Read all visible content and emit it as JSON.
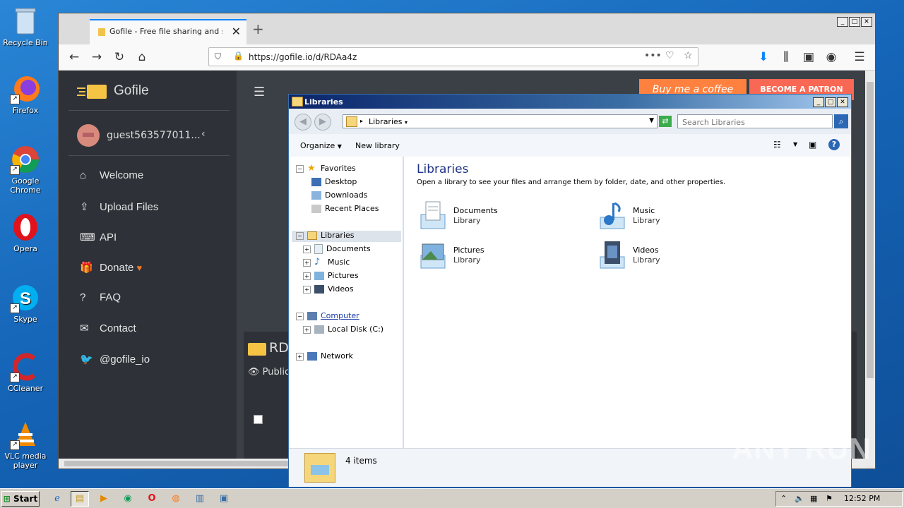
{
  "desktop": {
    "icons": [
      {
        "label": "Recycle Bin",
        "icon": "recycle-bin-icon"
      },
      {
        "label": "Firefox",
        "icon": "firefox-icon"
      },
      {
        "label": "Google Chrome",
        "icon": "chrome-icon"
      },
      {
        "label": "Opera",
        "icon": "opera-icon"
      },
      {
        "label": "Skype",
        "icon": "skype-icon"
      },
      {
        "label": "CCleaner",
        "icon": "ccleaner-icon"
      },
      {
        "label": "VLC media player",
        "icon": "vlc-icon"
      }
    ],
    "watermark": "ANY RUN"
  },
  "browser": {
    "tab_title": "Gofile - Free file sharing and storage",
    "url": "https://gofile.io/d/RDAa4z",
    "new_tab": "+"
  },
  "gofile": {
    "logo_text": "Gofile",
    "username": "guest563577011...",
    "menu": [
      {
        "label": "Welcome",
        "icon": "home-icon"
      },
      {
        "label": "Upload Files",
        "icon": "upload-file-icon"
      },
      {
        "label": "API",
        "icon": "api-icon"
      },
      {
        "label": "Donate",
        "icon": "gift-icon"
      },
      {
        "label": "FAQ",
        "icon": "question-icon"
      },
      {
        "label": "Contact",
        "icon": "envelope-icon"
      },
      {
        "label": "@gofile_io",
        "icon": "twitter-icon"
      }
    ],
    "buy_coffee": "Buy me a coffee",
    "become_patron": "BECOME A PATRON",
    "folder_name": "RD",
    "visibility": "Public"
  },
  "explorer": {
    "title": "Libraries",
    "breadcrumb": "Libraries",
    "search_placeholder": "Search Libraries",
    "commands": {
      "organize": "Organize",
      "new_library": "New library"
    },
    "heading": "Libraries",
    "subheading": "Open a library to see your files and arrange them by folder, date, and other properties.",
    "nav": {
      "favorites": "Favorites",
      "favorites_items": [
        "Desktop",
        "Downloads",
        "Recent Places"
      ],
      "libraries": "Libraries",
      "libraries_items": [
        "Documents",
        "Music",
        "Pictures",
        "Videos"
      ],
      "computer": "Computer",
      "local_disk": "Local Disk (C:)",
      "network": "Network"
    },
    "tiles": [
      {
        "name": "Documents",
        "type": "Library",
        "icon": "documents-library-icon"
      },
      {
        "name": "Music",
        "type": "Library",
        "icon": "music-library-icon"
      },
      {
        "name": "Pictures",
        "type": "Library",
        "icon": "pictures-library-icon"
      },
      {
        "name": "Videos",
        "type": "Library",
        "icon": "videos-library-icon"
      }
    ],
    "status": "4 items"
  },
  "taskbar": {
    "start": "Start",
    "clock": "12:52 PM"
  }
}
